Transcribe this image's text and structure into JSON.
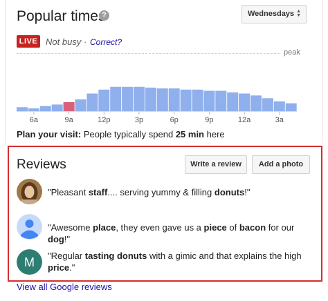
{
  "popular_times": {
    "title": "Popular times",
    "help_icon": "help-icon",
    "day_selected": "Wednesdays",
    "live_badge": "LIVE",
    "live_status": "Not busy",
    "live_separator": "·",
    "correct_link": "Correct?",
    "peak_label": "peak",
    "plan_label": "Plan your visit:",
    "plan_text_pre": "People typically spend",
    "plan_duration": "25 min",
    "plan_text_post": "here"
  },
  "chart_data": {
    "type": "bar",
    "hours": [
      "5a",
      "6a",
      "7a",
      "8a",
      "9a",
      "10a",
      "11a",
      "12p",
      "1p",
      "2p",
      "3p",
      "4p",
      "5p",
      "6p",
      "7p",
      "8p",
      "9p",
      "10p",
      "11p",
      "12a",
      "1a",
      "2a",
      "3a",
      "4a"
    ],
    "tick_labels": [
      {
        "hour_index": 1,
        "label": "6a"
      },
      {
        "hour_index": 4,
        "label": "9a"
      },
      {
        "hour_index": 7,
        "label": "12p"
      },
      {
        "hour_index": 10,
        "label": "3p"
      },
      {
        "hour_index": 13,
        "label": "6p"
      },
      {
        "hour_index": 16,
        "label": "9p"
      },
      {
        "hour_index": 19,
        "label": "12a"
      },
      {
        "hour_index": 22,
        "label": "3a"
      }
    ],
    "values": [
      10,
      7,
      13,
      17,
      18,
      30,
      45,
      55,
      62,
      62,
      62,
      60,
      58,
      58,
      55,
      55,
      52,
      52,
      48,
      45,
      40,
      33,
      25,
      20
    ],
    "current_hour_index": 4,
    "live_value": 23,
    "ylim": [
      0,
      100
    ],
    "colors": {
      "bar": "#8fb0ec",
      "live": "#d9607c",
      "baseline": "#dddddd"
    }
  },
  "reviews": {
    "title": "Reviews",
    "write_review_label": "Write a review",
    "add_photo_label": "Add a photo",
    "items": [
      {
        "avatar": "photo-avatar",
        "segments": [
          [
            "\"Pleasant ",
            false
          ],
          [
            "staff",
            true
          ],
          [
            ".... serving yummy & filling ",
            false
          ],
          [
            "donuts",
            true
          ],
          [
            "!\"",
            false
          ]
        ]
      },
      {
        "avatar": "person-placeholder-icon",
        "segments": [
          [
            "\"Awesome ",
            false
          ],
          [
            "place",
            true
          ],
          [
            ", they even gave us a ",
            false
          ],
          [
            "piece",
            true
          ],
          [
            " of ",
            false
          ],
          [
            "bacon",
            true
          ],
          [
            " for our ",
            false
          ],
          [
            "dog",
            true
          ],
          [
            "!\"",
            false
          ]
        ]
      },
      {
        "avatar": "letter-avatar",
        "avatar_letter": "M",
        "avatar_color": "#2e7d73",
        "segments": [
          [
            "\"Regular ",
            false
          ],
          [
            "tasting donuts",
            true
          ],
          [
            " with a gimic and that explains the high ",
            false
          ],
          [
            "price",
            true
          ],
          [
            ".\"",
            false
          ]
        ]
      }
    ],
    "view_all": "View all Google reviews"
  }
}
